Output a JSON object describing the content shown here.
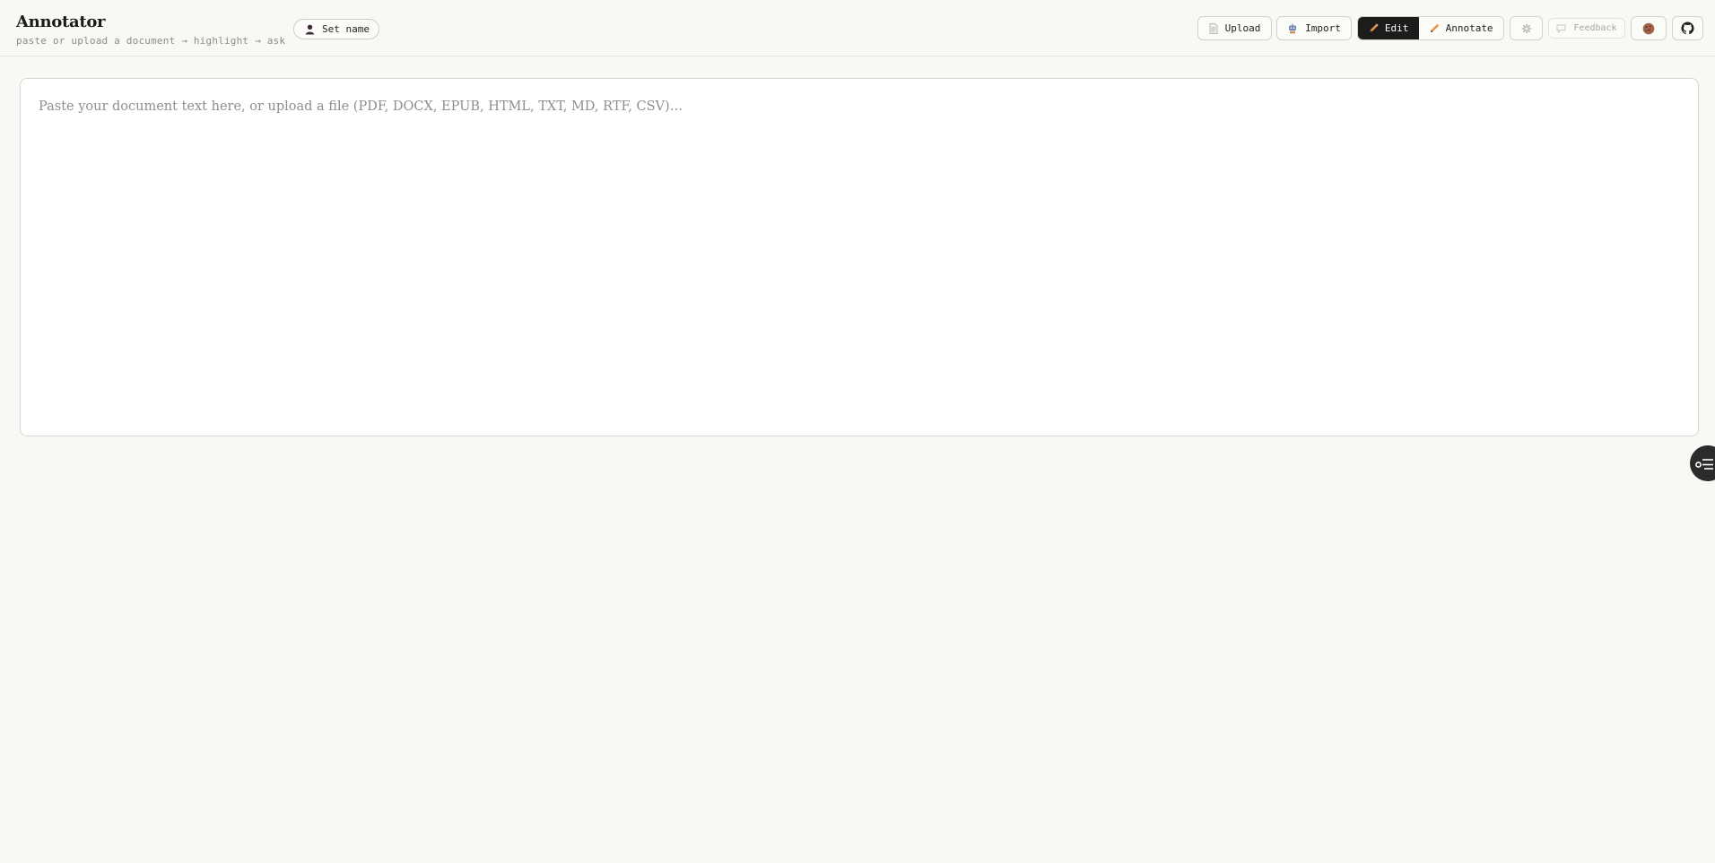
{
  "header": {
    "title": "Annotator",
    "subtitle": "paste or upload a document → highlight → ask",
    "set_name_label": "Set name",
    "upload_label": "Upload",
    "import_label": "Import",
    "mode": {
      "edit_label": "Edit",
      "annotate_label": "Annotate",
      "active": "Edit"
    },
    "feedback_label": "Feedback"
  },
  "editor": {
    "value": "",
    "placeholder": "Paste your document text here, or upload a file (PDF, DOCX, EPUB, HTML, TXT, MD, RTF, CSV)…"
  },
  "icons": {
    "set_name": "person-icon",
    "upload": "document-icon",
    "import": "robot-icon",
    "edit": "pencil-icon",
    "annotate": "pencil-icon",
    "settings": "gear-icon",
    "feedback": "chat-icon",
    "theme": "cookie-icon",
    "github": "github-icon",
    "fab": "toggle-list-icon"
  },
  "colors": {
    "background": "#f8f8f4",
    "accent_dark": "#1c1c1c",
    "pencil": "#e8954a"
  }
}
